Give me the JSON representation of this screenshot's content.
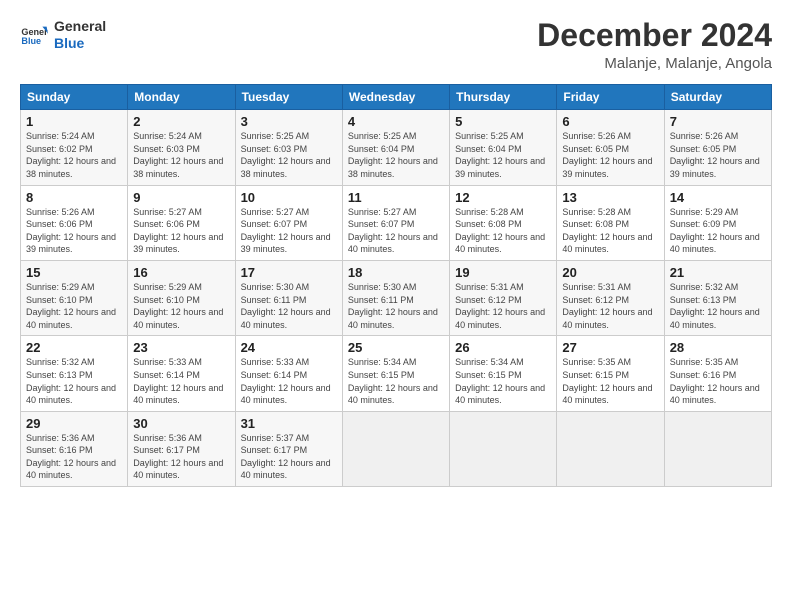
{
  "header": {
    "logo_general": "General",
    "logo_blue": "Blue",
    "main_title": "December 2024",
    "subtitle": "Malanje, Malanje, Angola"
  },
  "calendar": {
    "days_of_week": [
      "Sunday",
      "Monday",
      "Tuesday",
      "Wednesday",
      "Thursday",
      "Friday",
      "Saturday"
    ],
    "weeks": [
      [
        {
          "day": "1",
          "sunrise": "5:24 AM",
          "sunset": "6:02 PM",
          "daylight": "12 hours and 38 minutes."
        },
        {
          "day": "2",
          "sunrise": "5:24 AM",
          "sunset": "6:03 PM",
          "daylight": "12 hours and 38 minutes."
        },
        {
          "day": "3",
          "sunrise": "5:25 AM",
          "sunset": "6:03 PM",
          "daylight": "12 hours and 38 minutes."
        },
        {
          "day": "4",
          "sunrise": "5:25 AM",
          "sunset": "6:04 PM",
          "daylight": "12 hours and 38 minutes."
        },
        {
          "day": "5",
          "sunrise": "5:25 AM",
          "sunset": "6:04 PM",
          "daylight": "12 hours and 39 minutes."
        },
        {
          "day": "6",
          "sunrise": "5:26 AM",
          "sunset": "6:05 PM",
          "daylight": "12 hours and 39 minutes."
        },
        {
          "day": "7",
          "sunrise": "5:26 AM",
          "sunset": "6:05 PM",
          "daylight": "12 hours and 39 minutes."
        }
      ],
      [
        {
          "day": "8",
          "sunrise": "5:26 AM",
          "sunset": "6:06 PM",
          "daylight": "12 hours and 39 minutes."
        },
        {
          "day": "9",
          "sunrise": "5:27 AM",
          "sunset": "6:06 PM",
          "daylight": "12 hours and 39 minutes."
        },
        {
          "day": "10",
          "sunrise": "5:27 AM",
          "sunset": "6:07 PM",
          "daylight": "12 hours and 39 minutes."
        },
        {
          "day": "11",
          "sunrise": "5:27 AM",
          "sunset": "6:07 PM",
          "daylight": "12 hours and 40 minutes."
        },
        {
          "day": "12",
          "sunrise": "5:28 AM",
          "sunset": "6:08 PM",
          "daylight": "12 hours and 40 minutes."
        },
        {
          "day": "13",
          "sunrise": "5:28 AM",
          "sunset": "6:08 PM",
          "daylight": "12 hours and 40 minutes."
        },
        {
          "day": "14",
          "sunrise": "5:29 AM",
          "sunset": "6:09 PM",
          "daylight": "12 hours and 40 minutes."
        }
      ],
      [
        {
          "day": "15",
          "sunrise": "5:29 AM",
          "sunset": "6:10 PM",
          "daylight": "12 hours and 40 minutes."
        },
        {
          "day": "16",
          "sunrise": "5:29 AM",
          "sunset": "6:10 PM",
          "daylight": "12 hours and 40 minutes."
        },
        {
          "day": "17",
          "sunrise": "5:30 AM",
          "sunset": "6:11 PM",
          "daylight": "12 hours and 40 minutes."
        },
        {
          "day": "18",
          "sunrise": "5:30 AM",
          "sunset": "6:11 PM",
          "daylight": "12 hours and 40 minutes."
        },
        {
          "day": "19",
          "sunrise": "5:31 AM",
          "sunset": "6:12 PM",
          "daylight": "12 hours and 40 minutes."
        },
        {
          "day": "20",
          "sunrise": "5:31 AM",
          "sunset": "6:12 PM",
          "daylight": "12 hours and 40 minutes."
        },
        {
          "day": "21",
          "sunrise": "5:32 AM",
          "sunset": "6:13 PM",
          "daylight": "12 hours and 40 minutes."
        }
      ],
      [
        {
          "day": "22",
          "sunrise": "5:32 AM",
          "sunset": "6:13 PM",
          "daylight": "12 hours and 40 minutes."
        },
        {
          "day": "23",
          "sunrise": "5:33 AM",
          "sunset": "6:14 PM",
          "daylight": "12 hours and 40 minutes."
        },
        {
          "day": "24",
          "sunrise": "5:33 AM",
          "sunset": "6:14 PM",
          "daylight": "12 hours and 40 minutes."
        },
        {
          "day": "25",
          "sunrise": "5:34 AM",
          "sunset": "6:15 PM",
          "daylight": "12 hours and 40 minutes."
        },
        {
          "day": "26",
          "sunrise": "5:34 AM",
          "sunset": "6:15 PM",
          "daylight": "12 hours and 40 minutes."
        },
        {
          "day": "27",
          "sunrise": "5:35 AM",
          "sunset": "6:15 PM",
          "daylight": "12 hours and 40 minutes."
        },
        {
          "day": "28",
          "sunrise": "5:35 AM",
          "sunset": "6:16 PM",
          "daylight": "12 hours and 40 minutes."
        }
      ],
      [
        {
          "day": "29",
          "sunrise": "5:36 AM",
          "sunset": "6:16 PM",
          "daylight": "12 hours and 40 minutes."
        },
        {
          "day": "30",
          "sunrise": "5:36 AM",
          "sunset": "6:17 PM",
          "daylight": "12 hours and 40 minutes."
        },
        {
          "day": "31",
          "sunrise": "5:37 AM",
          "sunset": "6:17 PM",
          "daylight": "12 hours and 40 minutes."
        },
        null,
        null,
        null,
        null
      ]
    ]
  }
}
